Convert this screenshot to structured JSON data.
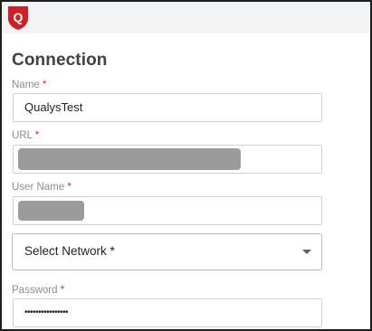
{
  "app": {
    "logo_icon": "qualys-shield-logo",
    "logo_letter": "Q",
    "brand_color": "#d21f26"
  },
  "form": {
    "title": "Connection",
    "required_marker": "*",
    "name": {
      "label": "Name",
      "value": "QualysTest"
    },
    "url": {
      "label": "URL",
      "value_redacted": true
    },
    "username": {
      "label": "User Name",
      "value_redacted": true
    },
    "network": {
      "placeholder": "Select Network *",
      "icon": "chevron-down-icon"
    },
    "password": {
      "label": "Password",
      "value": "••••••••••••••••"
    }
  }
}
